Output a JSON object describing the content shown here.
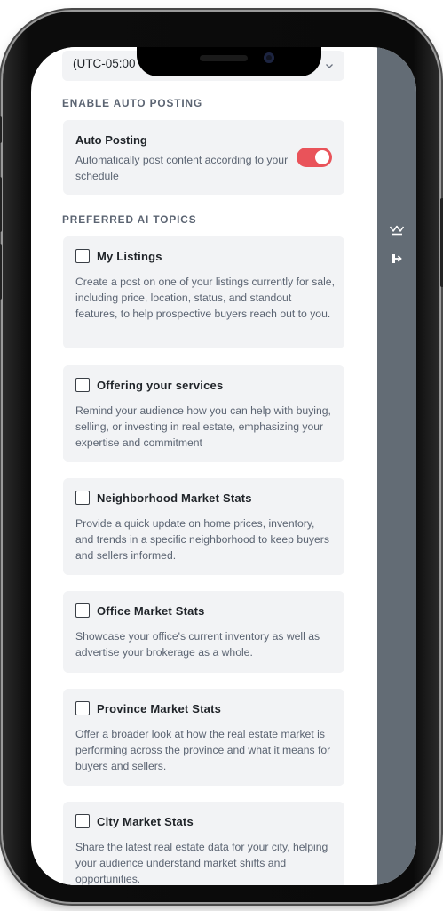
{
  "timezone": {
    "value": "(UTC-05:00"
  },
  "auto_posting_section": {
    "heading": "ENABLE AUTO POSTING",
    "title": "Auto Posting",
    "description": "Automatically post content according to your schedule",
    "enabled": true
  },
  "topics_section": {
    "heading": "PREFERRED AI TOPICS",
    "topics": [
      {
        "title": "My Listings",
        "description": "Create a post on one of your listings currently for sale, including price, location, status, and standout features, to help prospective buyers reach out to you.",
        "checked": false
      },
      {
        "title": "Offering your services",
        "description": "Remind your audience how you can help with buying, selling, or investing in real estate, emphasizing your expertise and commitment",
        "checked": false
      },
      {
        "title": "Neighborhood Market Stats",
        "description": "Provide a quick update on home prices, inventory, and trends in a specific neighborhood to keep buyers and sellers informed.",
        "checked": false
      },
      {
        "title": "Office Market Stats",
        "description": "Showcase your office's current inventory as well as advertise your brokerage as a whole.",
        "checked": false
      },
      {
        "title": "Province Market Stats",
        "description": "Offer a broader look at how the real estate market is performing across the province and what it means for buyers and sellers.",
        "checked": false
      },
      {
        "title": "City Market Stats",
        "description": "Share the latest real estate data for your city, helping your audience understand market shifts and opportunities.",
        "checked": false
      }
    ]
  },
  "side_rail": {
    "icons": [
      "crown-icon",
      "logout-icon"
    ]
  },
  "colors": {
    "accent": "#e9535a",
    "rail": "#636c75",
    "card": "#f2f3f5"
  }
}
